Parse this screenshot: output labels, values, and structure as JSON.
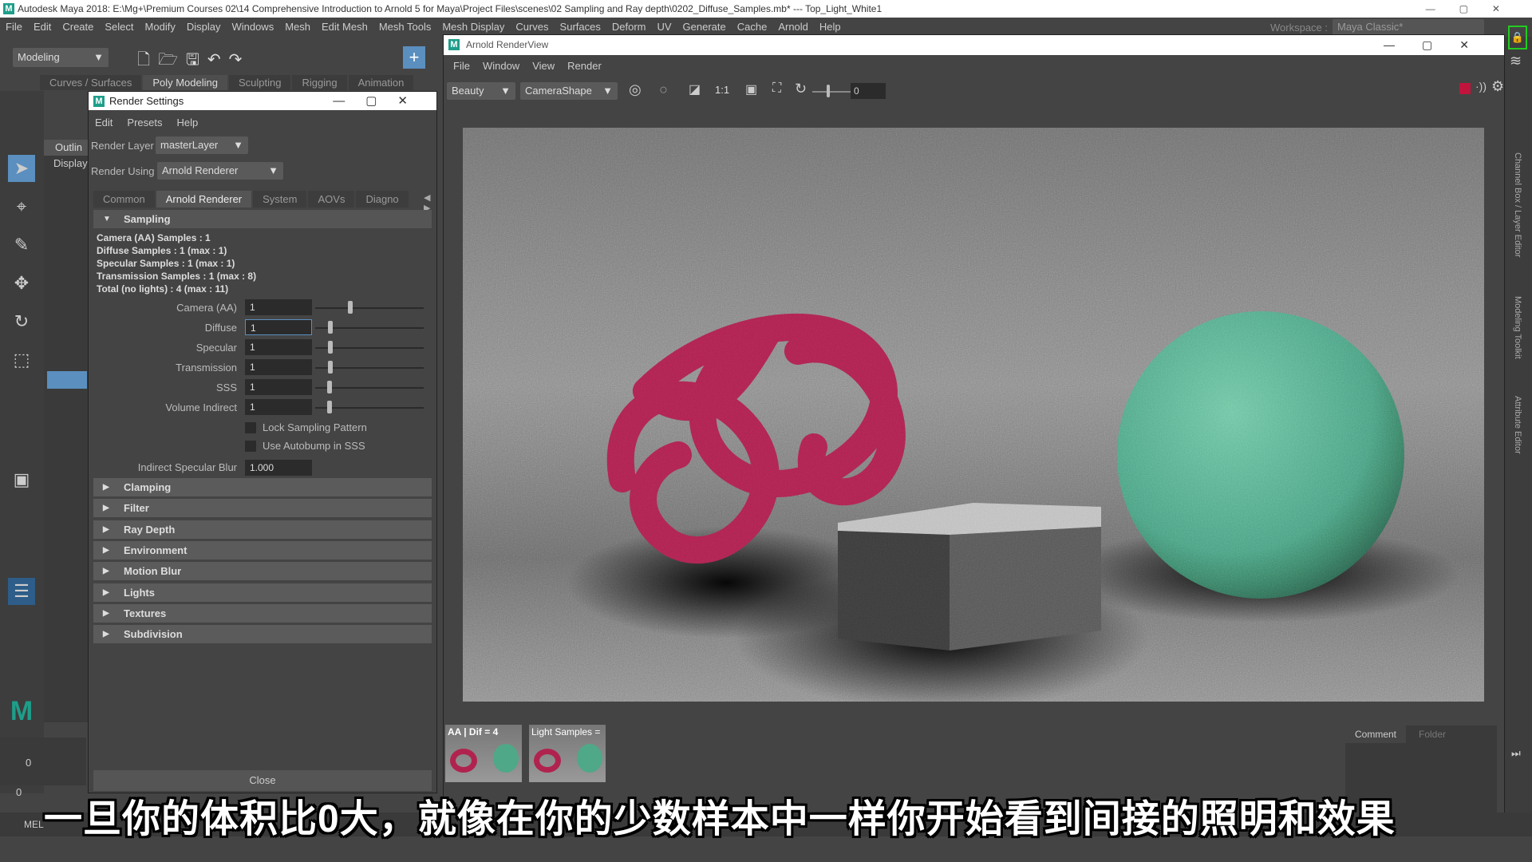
{
  "app": {
    "title": "Autodesk Maya 2018: E:\\Mg+\\Premium Courses 02\\14 Comprehensive Introduction to Arnold 5 for Maya\\Project Files\\scenes\\02 Sampling and Ray depth\\0202_Diffuse_Samples.mb*  ---  Top_Light_White1",
    "menu": [
      "File",
      "Edit",
      "Create",
      "Select",
      "Modify",
      "Display",
      "Windows",
      "Mesh",
      "Edit Mesh",
      "Mesh Tools",
      "Mesh Display",
      "Curves",
      "Surfaces",
      "Deform",
      "UV",
      "Generate",
      "Cache",
      "Arnold",
      "Help"
    ],
    "mode": "Modeling",
    "workspace_label": "Workspace :",
    "workspace": "Maya Classic*",
    "shelf_tabs": [
      "Curves / Surfaces",
      "Poly Modeling",
      "Sculpting",
      "Rigging",
      "Animation"
    ],
    "outliner_label": "Outlin",
    "display_label": "Display",
    "mel_label": "MEL",
    "frame_start": "0",
    "frame_current": "0",
    "frame_zero": "0"
  },
  "render_settings": {
    "title": "Render Settings",
    "menu": [
      "Edit",
      "Presets",
      "Help"
    ],
    "render_layer_label": "Render Layer",
    "render_layer": "masterLayer",
    "render_using_label": "Render Using",
    "render_using": "Arnold Renderer",
    "tabs": [
      "Common",
      "Arnold Renderer",
      "System",
      "AOVs",
      "Diagno"
    ],
    "sampling": {
      "title": "Sampling",
      "info": [
        "Camera (AA) Samples : 1",
        "Diffuse Samples : 1 (max : 1)",
        "Specular Samples : 1 (max : 1)",
        "Transmission Samples : 1 (max : 8)",
        "Total (no lights) : 4 (max : 11)"
      ],
      "fields": [
        {
          "label": "Camera (AA)",
          "value": "1",
          "slider": 0.3
        },
        {
          "label": "Diffuse",
          "value": "1",
          "slider": 0.12
        },
        {
          "label": "Specular",
          "value": "1",
          "slider": 0.12
        },
        {
          "label": "Transmission",
          "value": "1",
          "slider": 0.12
        },
        {
          "label": "SSS",
          "value": "1",
          "slider": 0.11
        },
        {
          "label": "Volume Indirect",
          "value": "1",
          "slider": 0.11
        }
      ],
      "lock_sampling": "Lock Sampling Pattern",
      "autobump": "Use Autobump in SSS",
      "indirect_blur_label": "Indirect Specular Blur",
      "indirect_blur": "1.000"
    },
    "sections": [
      "Clamping",
      "Filter",
      "Ray Depth",
      "Environment",
      "Motion Blur",
      "Lights",
      "Textures",
      "Subdivision"
    ],
    "close": "Close"
  },
  "render_view": {
    "title": "Arnold RenderView",
    "menu": [
      "File",
      "Window",
      "View",
      "Render"
    ],
    "aov": "Beauty",
    "camera": "CameraShape",
    "ratio": "1:1",
    "exposure": "0",
    "snapshots": [
      "AA | Dif = 4",
      "Light Samples ="
    ],
    "tabs": [
      "Comment",
      "Folder"
    ],
    "colors": {
      "torus": "#b0234f",
      "sphere": "#4fa887",
      "stop": "#c0143c"
    }
  },
  "subtitle": "一旦你的体积比0大，就像在你的少数样本中一样你开始看到间接的照明和效果",
  "right_panel": [
    "Channel Box / Layer Editor",
    "Modeling Toolkit",
    "Attribute Editor"
  ]
}
